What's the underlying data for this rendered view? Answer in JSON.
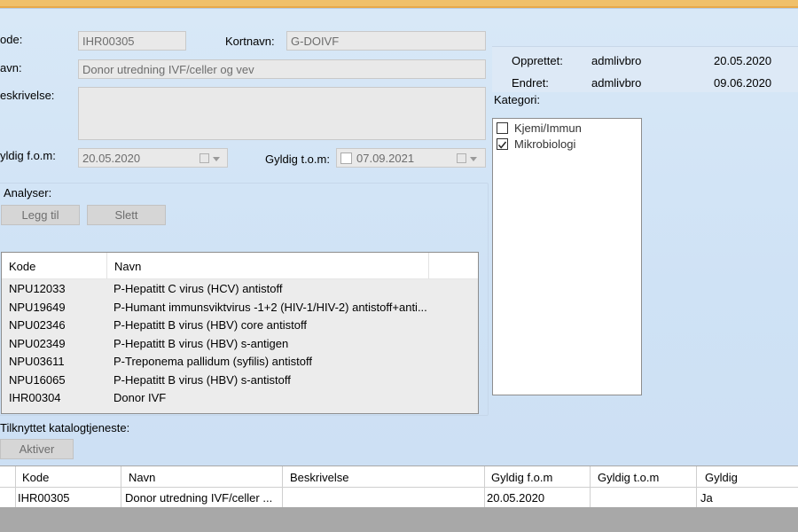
{
  "form": {
    "kode_label": "ode:",
    "kode_value": "IHR00305",
    "kortnavn_label": "Kortnavn:",
    "kortnavn_value": "G-DOIVF",
    "navn_label": "avn:",
    "navn_value": "Donor utredning IVF/celler og vev",
    "beskrivelse_label": "eskrivelse:",
    "beskrivelse_value": "",
    "gyldig_fom_label": "yldig f.o.m:",
    "gyldig_fom_value": "20.05.2020",
    "gyldig_tom_label": "Gyldig t.o.m:",
    "gyldig_tom_value": "07.09.2021"
  },
  "info": {
    "opprettet_label": "Opprettet:",
    "opprettet_user": "admlivbro",
    "opprettet_date": "20.05.2020",
    "endret_label": "Endret:",
    "endret_user": "admlivbro",
    "endret_date": "09.06.2020"
  },
  "kategori": {
    "label": "Kategori:",
    "items": [
      {
        "label": "Kjemi/Immun",
        "checked": false
      },
      {
        "label": "Mikrobiologi",
        "checked": true
      }
    ]
  },
  "analyser": {
    "label": "Analyser:",
    "add_button": "Legg til",
    "delete_button": "Slett",
    "columns": [
      "Kode",
      "Navn"
    ],
    "rows": [
      {
        "kode": "NPU12033",
        "navn": "P-Hepatitt C virus (HCV) antistoff"
      },
      {
        "kode": "NPU19649",
        "navn": "P-Humant immunsviktvirus -1+2 (HIV-1/HIV-2) antistoff+anti..."
      },
      {
        "kode": "NPU02346",
        "navn": "P-Hepatitt B virus (HBV) core antistoff"
      },
      {
        "kode": "NPU02349",
        "navn": "P-Hepatitt B virus (HBV) s-antigen"
      },
      {
        "kode": "NPU03611",
        "navn": "P-Treponema pallidum (syfilis) antistoff"
      },
      {
        "kode": "NPU16065",
        "navn": "P-Hepatitt B virus (HBV) s-antistoff"
      },
      {
        "kode": "IHR00304",
        "navn": "Donor IVF"
      }
    ]
  },
  "katalog": {
    "label": "Tilknyttet katalogtjeneste:",
    "button": "Aktiver"
  },
  "list": {
    "columns": [
      "Kode",
      "Navn",
      "Beskrivelse",
      "Gyldig f.o.m",
      "Gyldig t.o.m",
      "Gyldig"
    ],
    "rows": [
      {
        "kode": "IHR00305",
        "navn": "Donor utredning IVF/celler ...",
        "beskrivelse": "",
        "fom": "20.05.2020",
        "tom": "",
        "gyldig": "Ja"
      }
    ]
  }
}
